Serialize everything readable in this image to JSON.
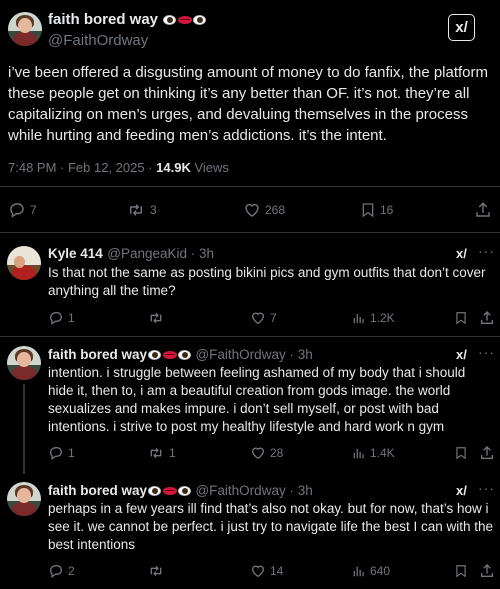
{
  "main_post": {
    "author_name": "faith bored way",
    "author_handle": "@FaithOrdway",
    "text": "i’ve been offered a disgusting amount of money to do fanfix, the platform these people get on thinking it’s any better than OF. it’s not. they’re all capitalizing on men’s urges, and devaluing themselves in the process while hurting and feeding men’s addictions. it’s the intent.",
    "time": "7:48 PM · Feb 12, 2025 · ",
    "views_count": "14.9K",
    "views_label": " Views",
    "replies": "7",
    "reposts": "3",
    "likes": "268",
    "bookmarks": "16",
    "grok_label": "x/"
  },
  "replies": [
    {
      "author_name": "Kyle 414",
      "author_handle": "@PangeaKid · 3h",
      "text": "Is that not the same as posting bikini pics and gym outfits that don’t cover anything all the time?",
      "replies": "1",
      "reposts": "",
      "likes": "7",
      "views": "1.2K"
    },
    {
      "author_name": "faith bored way",
      "author_handle": "@FaithOrdway · 3h",
      "text": "intention. i struggle between feeling ashamed of my body that i should hide it, then to, i am a beautiful creation from gods image. the world sexualizes and makes impure. i don’t sell myself, or post with bad intentions. i strive to post my healthy lifestyle and hard work n gym",
      "replies": "1",
      "reposts": "1",
      "likes": "28",
      "views": "1.4K"
    },
    {
      "author_name": "faith bored way",
      "author_handle": "@FaithOrdway · 3h",
      "text": "perhaps in a few years ill find that’s also not okay. but for now, that’s how i see it. we cannot be perfect. i just try to navigate life the best I can with the best intentions",
      "replies": "2",
      "reposts": "",
      "likes": "14",
      "views": "640"
    }
  ],
  "icons": {
    "reply": "reply-icon",
    "repost": "repost-icon",
    "like": "heart-icon",
    "views": "views-icon",
    "bookmark": "bookmark-icon",
    "share": "share-icon",
    "grok": "grok-icon",
    "more": "more-icon"
  }
}
